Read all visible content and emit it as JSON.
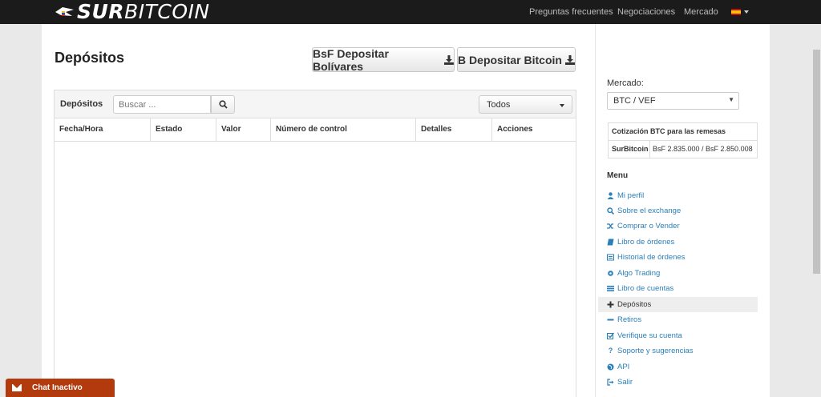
{
  "header": {
    "logo_bold": "SUR",
    "logo_rest": "BITCOIN",
    "nav": [
      "Preguntas frecuentes",
      "Negociaciones",
      "Mercado"
    ],
    "language_icon": "spain-flag-icon"
  },
  "page": {
    "title": "Depósitos",
    "btn_bolivares": "BsF Depositar Bolívares",
    "btn_bitcoin": "B Depositar Bitcoin"
  },
  "panel": {
    "title": "Depósitos",
    "search_placeholder": "Buscar ...",
    "filter_value": "Todos",
    "columns": [
      "Fecha/Hora",
      "Estado",
      "Valor",
      "Número de control",
      "Detalles",
      "Acciones"
    ]
  },
  "sidebar": {
    "mercado_label": "Mercado:",
    "mercado_value": "BTC / VEF",
    "quote_title": "Cotización BTC para las remesas",
    "quote_name": "SurBitcoin",
    "quote_value": "BsF 2.835.000 / BsF 2.850.008",
    "menu_title": "Menu",
    "menu": [
      {
        "label": "Mi perfil",
        "icon": "user-icon"
      },
      {
        "label": "Sobre el exchange",
        "icon": "search-icon"
      },
      {
        "label": "Comprar o Vender",
        "icon": "shuffle-icon"
      },
      {
        "label": "Libro de órdenes",
        "icon": "book-icon"
      },
      {
        "label": "Historial de órdenes",
        "icon": "list-alt-icon"
      },
      {
        "label": "Algo Trading",
        "icon": "cog-icon"
      },
      {
        "label": "Libro de cuentas",
        "icon": "list-icon"
      },
      {
        "label": "Depósitos",
        "icon": "plus-icon",
        "active": true
      },
      {
        "label": "Retiros",
        "icon": "minus-icon"
      },
      {
        "label": "Verifique su cuenta",
        "icon": "check-icon"
      },
      {
        "label": "Soporte y sugerencias",
        "icon": "question-icon"
      },
      {
        "label": "API",
        "icon": "globe-icon"
      },
      {
        "label": "Salir",
        "icon": "sign-out-icon"
      }
    ]
  },
  "chat": {
    "label": "Chat Inactivo"
  },
  "colors": {
    "accent_link": "#2a7fb8",
    "chat_bg": "#b33a0c",
    "navbar_bg": "#1b1b1b"
  }
}
